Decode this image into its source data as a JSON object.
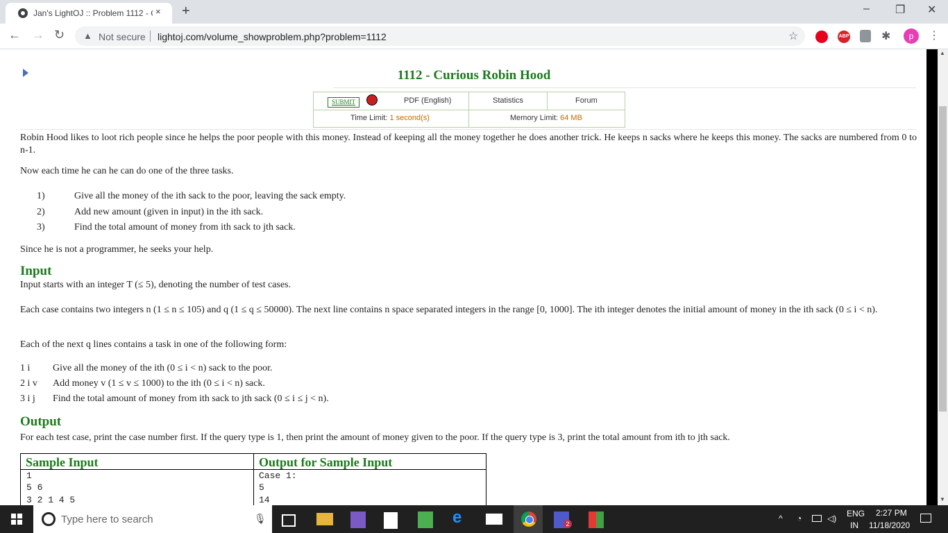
{
  "browser": {
    "tab_title": "Jan's LightOJ :: Problem 1112 - C",
    "tab_close": "×",
    "new_tab": "+",
    "win_min": "–",
    "win_max": "❐",
    "win_close": "✕",
    "back": "←",
    "forward": "→",
    "reload": "↻",
    "security_icon": "▲",
    "security_label": "Not secure",
    "url": "lightoj.com/volume_showproblem.php?problem=1112",
    "star": "☆",
    "abp_label": "ABP",
    "profile_initial": "p",
    "menu": "⋮",
    "puzzle": "✱"
  },
  "problem": {
    "title": "1112 - Curious Robin Hood",
    "submit_label": "SUBMIT",
    "pdf_label": "PDF (English)",
    "statistics_label": "Statistics",
    "forum_label": "Forum",
    "time_limit_label": "Time Limit:",
    "time_limit_value": "1 second(s)",
    "memory_limit_label": "Memory Limit:",
    "memory_limit_value": "64 MB"
  },
  "statement": {
    "intro": "Robin Hood likes to loot rich people since he helps the poor people with this money. Instead of keeping all the money together he does another trick. He keeps n sacks where he keeps this money. The sacks are numbered from 0 to n-1.",
    "tasks_intro": "Now each time he can he can do one of the three tasks.",
    "tasks": [
      {
        "num": "1)",
        "text": "Give all the money of the ith sack to the poor, leaving the sack empty."
      },
      {
        "num": "2)",
        "text": "Add new amount (given in input) in the ith sack."
      },
      {
        "num": "3)",
        "text": "Find the total amount of money from ith sack to jth sack."
      }
    ],
    "help": "Since he is not a programmer, he seeks your help."
  },
  "input": {
    "heading": "Input",
    "line1": "Input starts with an integer T (≤ 5), denoting the number of test cases.",
    "line2": "Each case contains two integers n (1 ≤ n ≤ 105) and q (1 ≤ q ≤ 50000). The next line contains n space separated integers in the range [0, 1000]. The ith integer denotes the initial amount of money in the ith sack (0 ≤ i < n).",
    "line3": "Each of the next q lines contains a task in one of the following form:",
    "forms": [
      {
        "code": "1 i",
        "text": "Give all the money of the ith (0 ≤ i < n) sack to the poor."
      },
      {
        "code": "2 i v",
        "text": "Add money v (1 ≤ v ≤ 1000) to the ith (0 ≤ i < n) sack."
      },
      {
        "code": "3 i j",
        "text": "Find the total amount of money from ith sack to jth sack (0 ≤ i ≤ j < n)."
      }
    ]
  },
  "output": {
    "heading": "Output",
    "line1": "For each test case, print the case number first. If the query type is 1, then print the amount of money given to the poor. If the query type is 3, print the total amount from ith to jth sack."
  },
  "sample": {
    "input_header": "Sample Input",
    "output_header": "Output for Sample Input",
    "input_lines": [
      "1",
      "5 6",
      "3 2 1 4 5"
    ],
    "output_lines": [
      "Case 1:",
      "5",
      "14"
    ]
  },
  "taskbar": {
    "search_placeholder": "Type here to search",
    "lang_top": "ENG",
    "lang_bottom": "IN",
    "time": "2:27 PM",
    "date": "11/18/2020",
    "teams_badge": "2"
  },
  "colors": {
    "heading_green": "#1c7a1c",
    "limit_orange": "#c46a00",
    "taskbar": "#202020"
  }
}
